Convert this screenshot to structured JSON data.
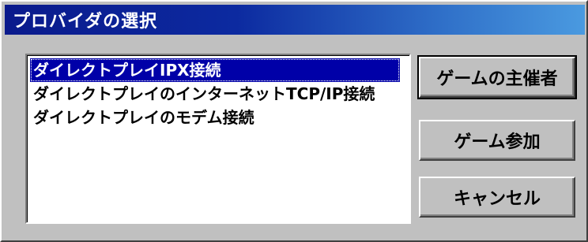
{
  "window": {
    "title": "プロバイダの選択"
  },
  "providers": {
    "items": [
      {
        "label": "ダイレクトプレイIPX接続",
        "selected": true
      },
      {
        "label": "ダイレクトプレイのインターネットTCP/IP接続",
        "selected": false
      },
      {
        "label": "ダイレクトプレイのモデム接続",
        "selected": false
      }
    ]
  },
  "buttons": {
    "host": "ゲームの主催者",
    "join": "ゲーム参加",
    "cancel": "キャンセル"
  },
  "colors": {
    "title_bar_start": "#0a1a8c",
    "title_bar_end": "#4a9ae0",
    "selection": "#0000a8",
    "face": "#c0c0c0"
  }
}
